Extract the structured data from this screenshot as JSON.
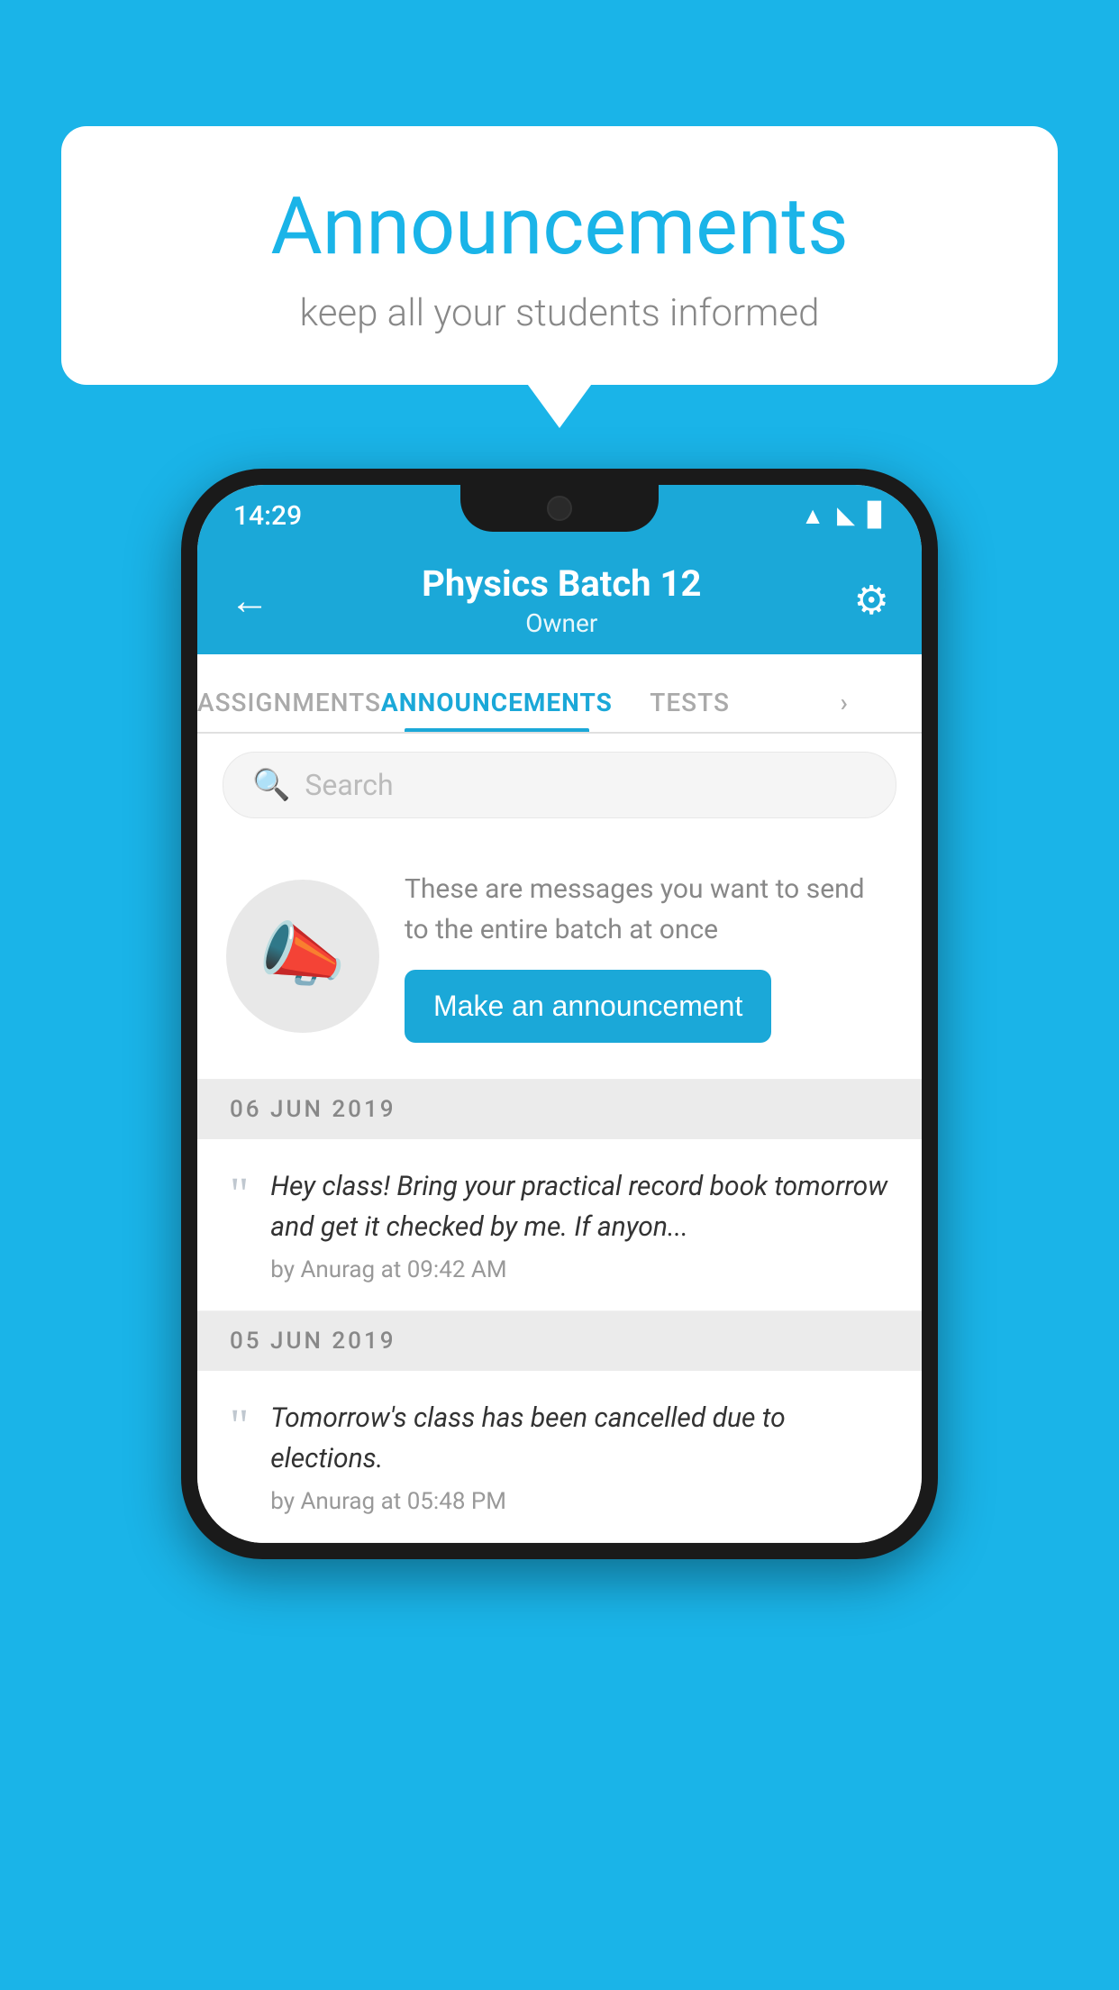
{
  "bubble": {
    "title": "Announcements",
    "subtitle": "keep all your students informed"
  },
  "statusBar": {
    "time": "14:29",
    "wifiIcon": "▲",
    "signalIcon": "▲",
    "batteryIcon": "▊"
  },
  "header": {
    "title": "Physics Batch 12",
    "subtitle": "Owner",
    "backIcon": "←",
    "settingsIcon": "⚙"
  },
  "tabs": [
    {
      "label": "ASSIGNMENTS",
      "active": false
    },
    {
      "label": "ANNOUNCEMENTS",
      "active": true
    },
    {
      "label": "TESTS",
      "active": false
    },
    {
      "label": "›",
      "active": false
    }
  ],
  "search": {
    "placeholder": "Search"
  },
  "promo": {
    "description": "These are messages you want to send to the entire batch at once",
    "buttonLabel": "Make an announcement"
  },
  "announcements": [
    {
      "date": "06  JUN  2019",
      "message": "Hey class! Bring your practical record book tomorrow and get it checked by me. If anyon...",
      "meta": "by Anurag at 09:42 AM"
    },
    {
      "date": "05  JUN  2019",
      "message": "Tomorrow's class has been cancelled due to elections.",
      "meta": "by Anurag at 05:48 PM"
    }
  ],
  "colors": {
    "primary": "#1ba8d8",
    "background": "#1ab4e8",
    "tabActive": "#1ba8d8",
    "promoButton": "#1ba8d8"
  }
}
